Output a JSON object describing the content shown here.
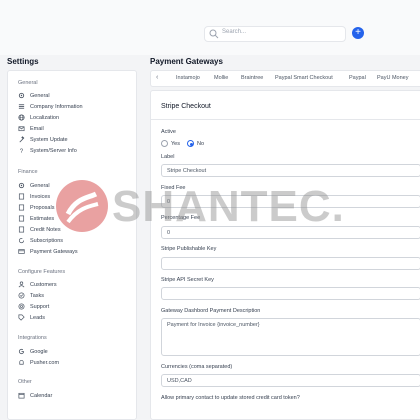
{
  "search": {
    "placeholder": "Search..."
  },
  "settings_title": "Settings",
  "sidebar": {
    "groups": [
      {
        "label": "General",
        "items": [
          "General",
          "Company Information",
          "Localization",
          "Email",
          "System Update",
          "System/Server Info"
        ]
      },
      {
        "label": "Finance",
        "items": [
          "General",
          "Invoices",
          "Proposals",
          "Estimates",
          "Credit Notes",
          "Subscriptions",
          "Payment Gateways"
        ]
      },
      {
        "label": "Configure Features",
        "items": [
          "Customers",
          "Tasks",
          "Support",
          "Leads"
        ]
      },
      {
        "label": "Integrations",
        "items": [
          "Google",
          "Pusher.com"
        ]
      },
      {
        "label": "Other",
        "items": [
          "Calendar"
        ]
      }
    ]
  },
  "page_title": "Payment Gateways",
  "tabs": [
    "Instamojo",
    "Mollie",
    "Braintree",
    "Paypal Smart Checkout",
    "Paypal",
    "PayU Money"
  ],
  "tab_prev": "‹",
  "panel": {
    "title": "Stripe Checkout",
    "active_label": "Active",
    "yes_label": "Yes",
    "no_label": "No",
    "label_label": "Label",
    "label_value": "Stripe Checkout",
    "fixed_fee_label": "Fixed Fee",
    "fixed_fee_value": "0",
    "percentage_fee_label": "Percentage Fee",
    "percentage_fee_value": "0",
    "publishable_key_label": "Stripe Publishable Key",
    "publishable_key_value": "",
    "secret_key_label": "Stripe API Secret Key",
    "secret_key_value": "",
    "description_label": "Gateway Dashbord Payment Description",
    "description_value": "Payment for Invoice {invoice_number}",
    "currencies_label": "Currencies (coma separated)",
    "currencies_value": "USD,CAD",
    "allow_update_label": "Allow primary contact to update stored credit card token?"
  },
  "watermark": {
    "text": "SHANTEC."
  },
  "colors": {
    "accent": "#2563eb",
    "watermark": "#e07a7a"
  }
}
